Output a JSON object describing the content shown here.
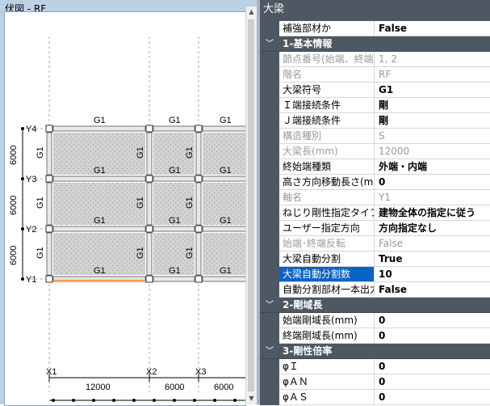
{
  "plan": {
    "title": "伏図 - RF",
    "beam_labels": [
      "G1",
      "G1",
      "G1",
      "G1",
      "G1",
      "G1",
      "G1",
      "G1",
      "G1",
      "G1",
      "G1",
      "G1"
    ],
    "column_labels": [
      "G1",
      "G1",
      "G1",
      "G1",
      "G1",
      "G1",
      "G1",
      "G1",
      "G1"
    ],
    "grid_y": [
      "Y4",
      "Y3",
      "Y2",
      "Y1"
    ],
    "grid_x": [
      "X1",
      "X2",
      "X3"
    ],
    "y_spacing": [
      "6000",
      "6000",
      "6000"
    ],
    "x_spacing": [
      "12000",
      "6000",
      "6000"
    ],
    "colors": {
      "slab": "#d2d2d2",
      "beam": "#e8e8e8",
      "highlight": "#f0a050",
      "grid": "#aaaaaa"
    }
  },
  "properties": {
    "panel_title": "大梁",
    "rows": [
      {
        "type": "prop",
        "name": "補強部材か",
        "value": "False",
        "ro": false
      },
      {
        "type": "cat",
        "label": "1-基本情報"
      },
      {
        "type": "prop",
        "name": "節点番号(始端、終端)",
        "value": "1, 2",
        "ro": true
      },
      {
        "type": "prop",
        "name": "階名",
        "value": "RF",
        "ro": true
      },
      {
        "type": "prop",
        "name": "大梁符号",
        "value": "G1",
        "ro": false
      },
      {
        "type": "prop",
        "name": "Ｉ端接続条件",
        "value": "剛",
        "ro": false
      },
      {
        "type": "prop",
        "name": "Ｊ端接続条件",
        "value": "剛",
        "ro": false
      },
      {
        "type": "prop",
        "name": "構造種別",
        "value": "S",
        "ro": true
      },
      {
        "type": "prop",
        "name": "大梁長(mm)",
        "value": "12000",
        "ro": true
      },
      {
        "type": "prop",
        "name": "終始端種類",
        "value": "外端・内端",
        "ro": false
      },
      {
        "type": "prop",
        "name": "高さ方向移動長さ(mm)",
        "value": "0",
        "ro": false
      },
      {
        "type": "prop",
        "name": "軸名",
        "value": "Y1",
        "ro": true
      },
      {
        "type": "prop",
        "name": "ねじり剛性指定タイプ",
        "value": "建物全体の指定に従う",
        "ro": false
      },
      {
        "type": "prop",
        "name": "ユーザー指定方向",
        "value": "方向指定なし",
        "ro": false
      },
      {
        "type": "prop",
        "name": "始端･終端反転",
        "value": "False",
        "ro": true
      },
      {
        "type": "prop",
        "name": "大梁自動分割",
        "value": "True",
        "ro": false
      },
      {
        "type": "prop",
        "name": "大梁自動分割数",
        "value": "10",
        "ro": false,
        "selected": true
      },
      {
        "type": "prop",
        "name": "自動分割部材一本出力",
        "value": "False",
        "ro": false
      },
      {
        "type": "cat",
        "label": "2-剛域長"
      },
      {
        "type": "prop",
        "name": "始端剛域長(mm)",
        "value": "0",
        "ro": false
      },
      {
        "type": "prop",
        "name": "終端剛域長(mm)",
        "value": "0",
        "ro": false
      },
      {
        "type": "cat",
        "label": "3-剛性倍率"
      },
      {
        "type": "prop",
        "name": "φＩ",
        "value": "0",
        "ro": false
      },
      {
        "type": "prop",
        "name": "φＡＮ",
        "value": "0",
        "ro": false
      },
      {
        "type": "prop",
        "name": "φＡＳ",
        "value": "0",
        "ro": false
      }
    ]
  }
}
